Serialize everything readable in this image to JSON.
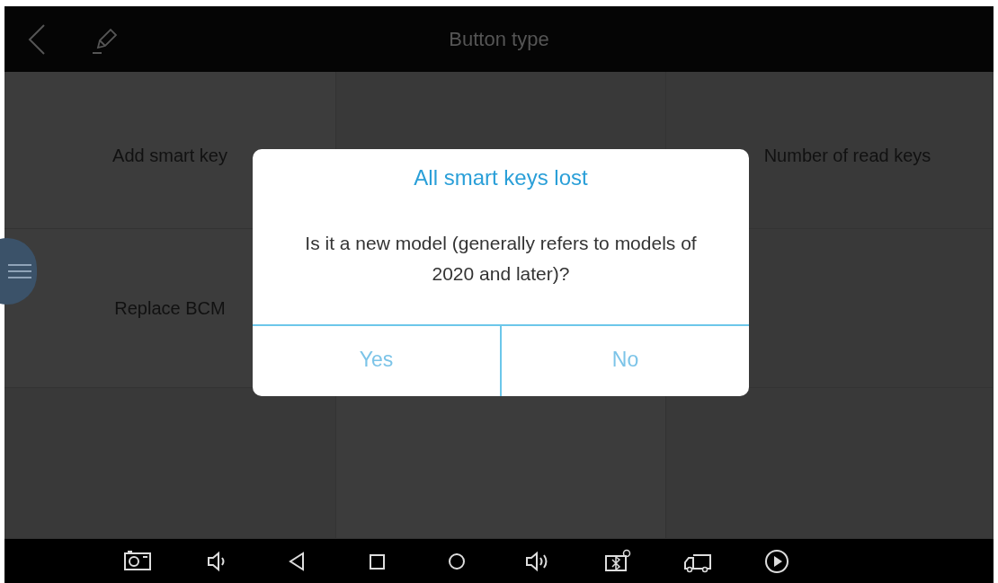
{
  "header": {
    "title": "Button type"
  },
  "grid": [
    {
      "kind": "option",
      "label": "Add smart key"
    },
    {
      "kind": "empty"
    },
    {
      "kind": "option",
      "label": "Number of read keys"
    },
    {
      "kind": "option",
      "label": "Replace BCM"
    },
    {
      "kind": "empty"
    },
    {
      "kind": "empty"
    },
    {
      "kind": "empty"
    },
    {
      "kind": "empty"
    }
  ],
  "dialog": {
    "title": "All smart keys lost",
    "message": "Is it a new model (generally refers to models of 2020 and later)?",
    "buttons": [
      "Yes",
      "No"
    ]
  },
  "nav_bar": [
    {
      "kind": "camera"
    },
    {
      "kind": "volume-down"
    },
    {
      "kind": "back"
    },
    {
      "kind": "recents"
    },
    {
      "kind": "home"
    },
    {
      "kind": "volume-up"
    },
    {
      "kind": "bluetooth"
    },
    {
      "kind": "truck"
    },
    {
      "kind": "play"
    }
  ]
}
